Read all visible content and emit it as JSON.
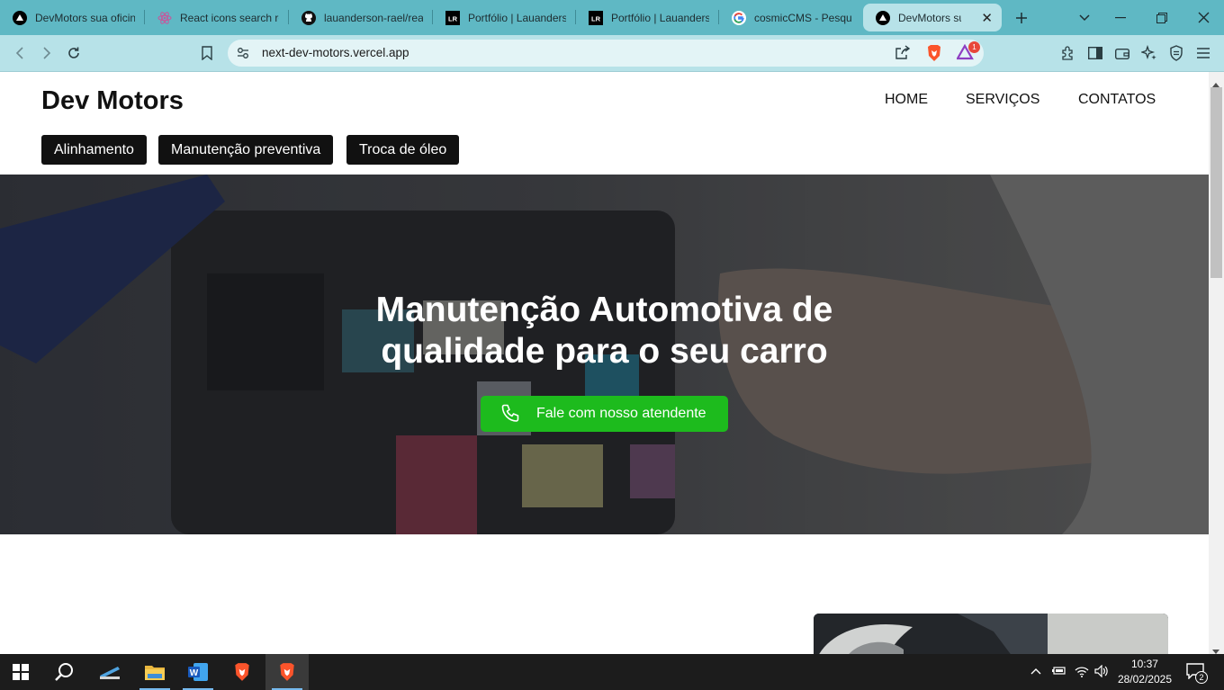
{
  "browser": {
    "tabs": [
      {
        "title": "DevMotors sua oficina",
        "favicon": "vercel-triangle-icon"
      },
      {
        "title": "React icons search re",
        "favicon": "react-icon"
      },
      {
        "title": "lauanderson-rael/rea",
        "favicon": "github-icon"
      },
      {
        "title": "Portfólio | Lauanders",
        "favicon": "lr-logo-icon"
      },
      {
        "title": "Portfólio | Lauanders",
        "favicon": "lr-logo-icon"
      },
      {
        "title": "cosmicCMS - Pesqui",
        "favicon": "google-icon"
      },
      {
        "title": "DevMotors sua o",
        "favicon": "vercel-triangle-icon",
        "active": true
      }
    ],
    "url": "next-dev-motors.vercel.app",
    "notification_count": "1"
  },
  "site": {
    "brand": "Dev Motors",
    "nav": [
      "HOME",
      "SERVIÇOS",
      "CONTATOS"
    ],
    "services": [
      "Alinhamento",
      "Manutenção preventiva",
      "Troca de óleo"
    ],
    "hero": {
      "title_line1": "Manutenção Automotiva de",
      "title_line2": "qualidade para o seu carro",
      "cta_label": "Fale com nosso atendente"
    }
  },
  "taskbar": {
    "time": "10:37",
    "date": "28/02/2025",
    "notifications": "2"
  },
  "colors": {
    "tab_strip": "#5fb8c4",
    "toolbar": "#b7e2e8",
    "cta_green": "#1dbb1d",
    "chip_black": "#111111"
  }
}
